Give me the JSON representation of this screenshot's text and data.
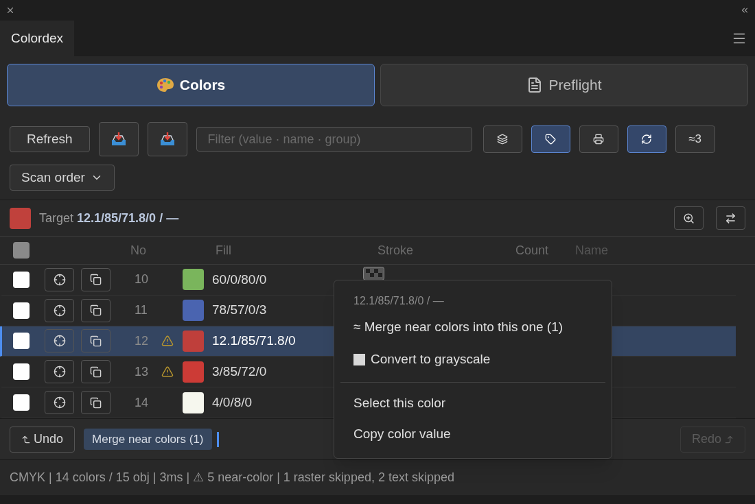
{
  "panel": {
    "title": "Colordex"
  },
  "modes": [
    {
      "label": "Colors",
      "kind": "palette",
      "selected": true
    },
    {
      "label": "Preflight",
      "kind": "document",
      "selected": false
    }
  ],
  "toolbar": {
    "refresh": "Refresh",
    "filter_placeholder": "Filter (value · name · group)",
    "toggles": [
      {
        "kind": "layers",
        "active": false
      },
      {
        "kind": "tag",
        "active": true
      },
      {
        "kind": "print",
        "active": false
      },
      {
        "kind": "sync",
        "active": true
      }
    ],
    "near": "≈3",
    "sort": "Scan order"
  },
  "target": {
    "color": "#c0413c",
    "text": "Target **12.1/85/71.8/0 / —**"
  },
  "table": {
    "select_all_checked": false,
    "columns": [
      "No",
      "Fill",
      "Stroke",
      "Count",
      "Name"
    ],
    "rows": [
      {
        "no": "10",
        "warning": false,
        "color": "#7ab55c",
        "fill": "60/0/80/0",
        "stroke_none": true,
        "selected": false,
        "checked": false
      },
      {
        "no": "11",
        "warning": false,
        "color": "#4a64b0",
        "fill": "78/57/0/3",
        "selected": false,
        "checked": false
      },
      {
        "no": "12",
        "warning": true,
        "color": "#bf3f3b",
        "fill": "12.1/85/71.8/0",
        "selected": true,
        "checked": false
      },
      {
        "no": "13",
        "warning": true,
        "color": "#cc3b36",
        "fill": "3/85/72/0",
        "selected": false,
        "checked": false
      },
      {
        "no": "14",
        "warning": false,
        "color": "#f6f7ee",
        "fill": "4/0/8/0",
        "selected": false,
        "checked": false
      }
    ]
  },
  "history": {
    "undo": "Undo",
    "entry": "Merge near colors (1)",
    "redo": "Redo",
    "redo_disabled": true
  },
  "status": "CMYK | 14 colors / 15 obj | 3ms | ⚠ 5 near-color | 1 raster skipped, 2 text skipped",
  "context_menu": {
    "header": "12.1/85/71.8/0 / —",
    "items": [
      {
        "label": "≈ Merge near colors into this one (1)",
        "kind": "plain"
      },
      {
        "label": "Convert to grayscale",
        "kind": "swatch"
      },
      {
        "kind": "separator"
      },
      {
        "label": "Select this color",
        "kind": "plain"
      },
      {
        "label": "Copy color value",
        "kind": "plain"
      }
    ]
  }
}
